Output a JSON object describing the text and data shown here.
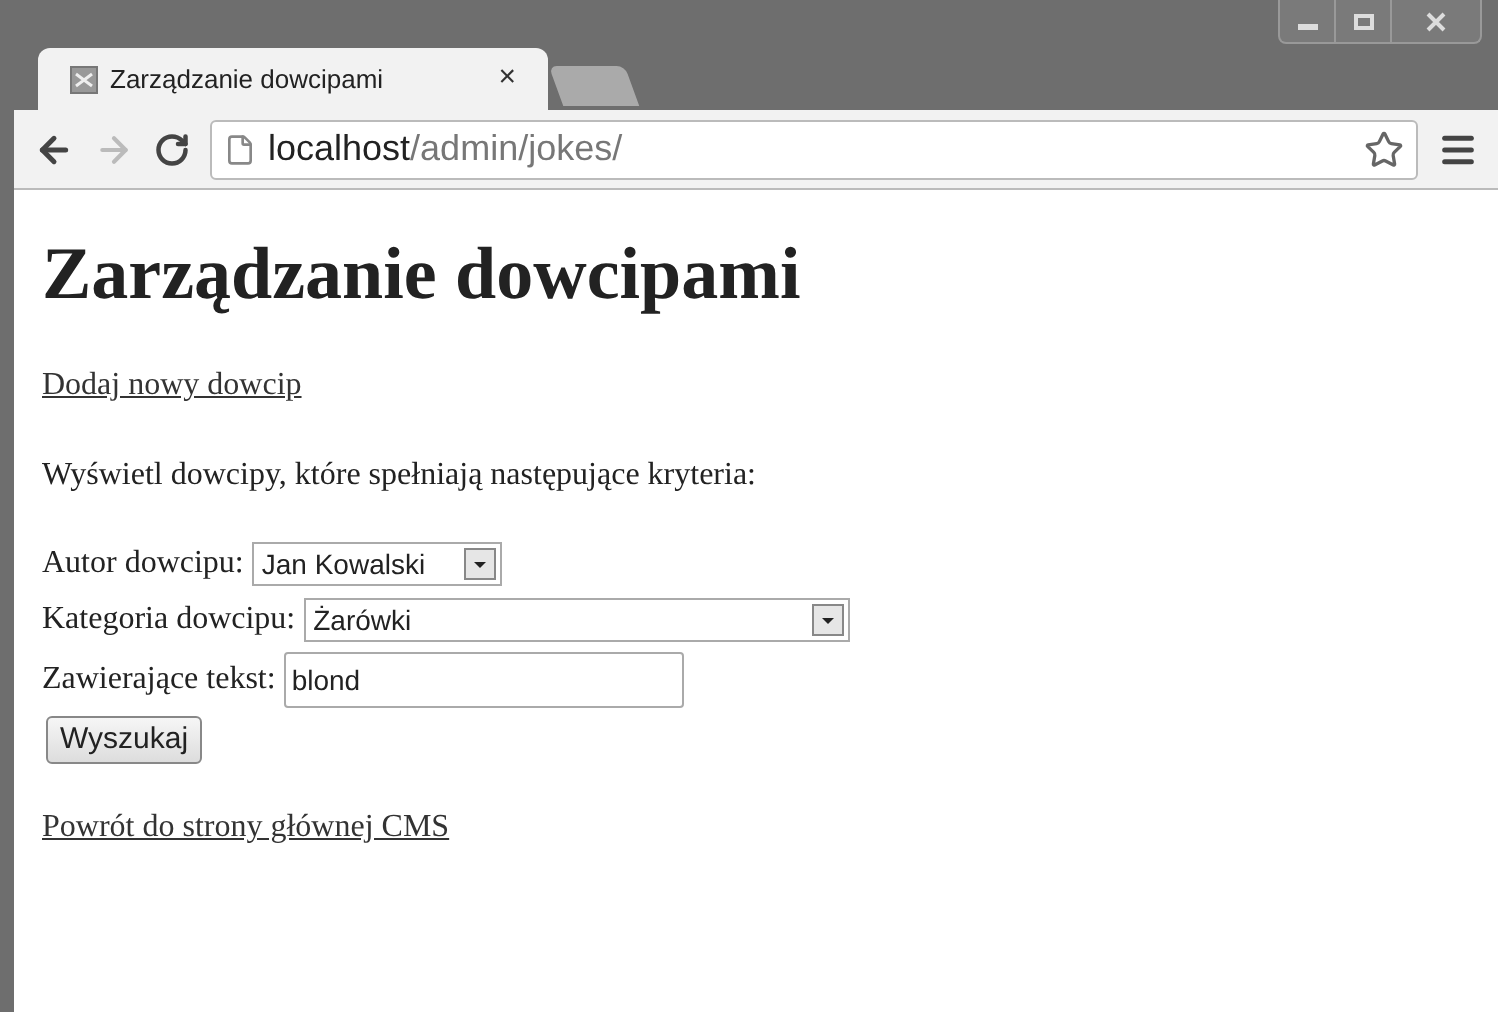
{
  "browser": {
    "tab_title": "Zarządzanie dowcipami",
    "tab_close": "×",
    "url_host": "localhost",
    "url_path": "/admin/jokes/"
  },
  "page": {
    "heading": "Zarządzanie dowcipami",
    "add_link": "Dodaj nowy dowcip",
    "intro": "Wyświetl dowcipy, które spełniają następujące kryteria:",
    "fields": [
      {
        "kind": "select",
        "label": "Autor dowcipu:",
        "value": "Jan Kowalski"
      },
      {
        "kind": "select",
        "label": "Kategoria dowcipu:",
        "value": "Żarówki"
      },
      {
        "kind": "text",
        "label": "Zawierające tekst:",
        "value": "blond"
      }
    ],
    "search_button": "Wyszukaj",
    "back_link": "Powrót do strony głównej CMS"
  }
}
